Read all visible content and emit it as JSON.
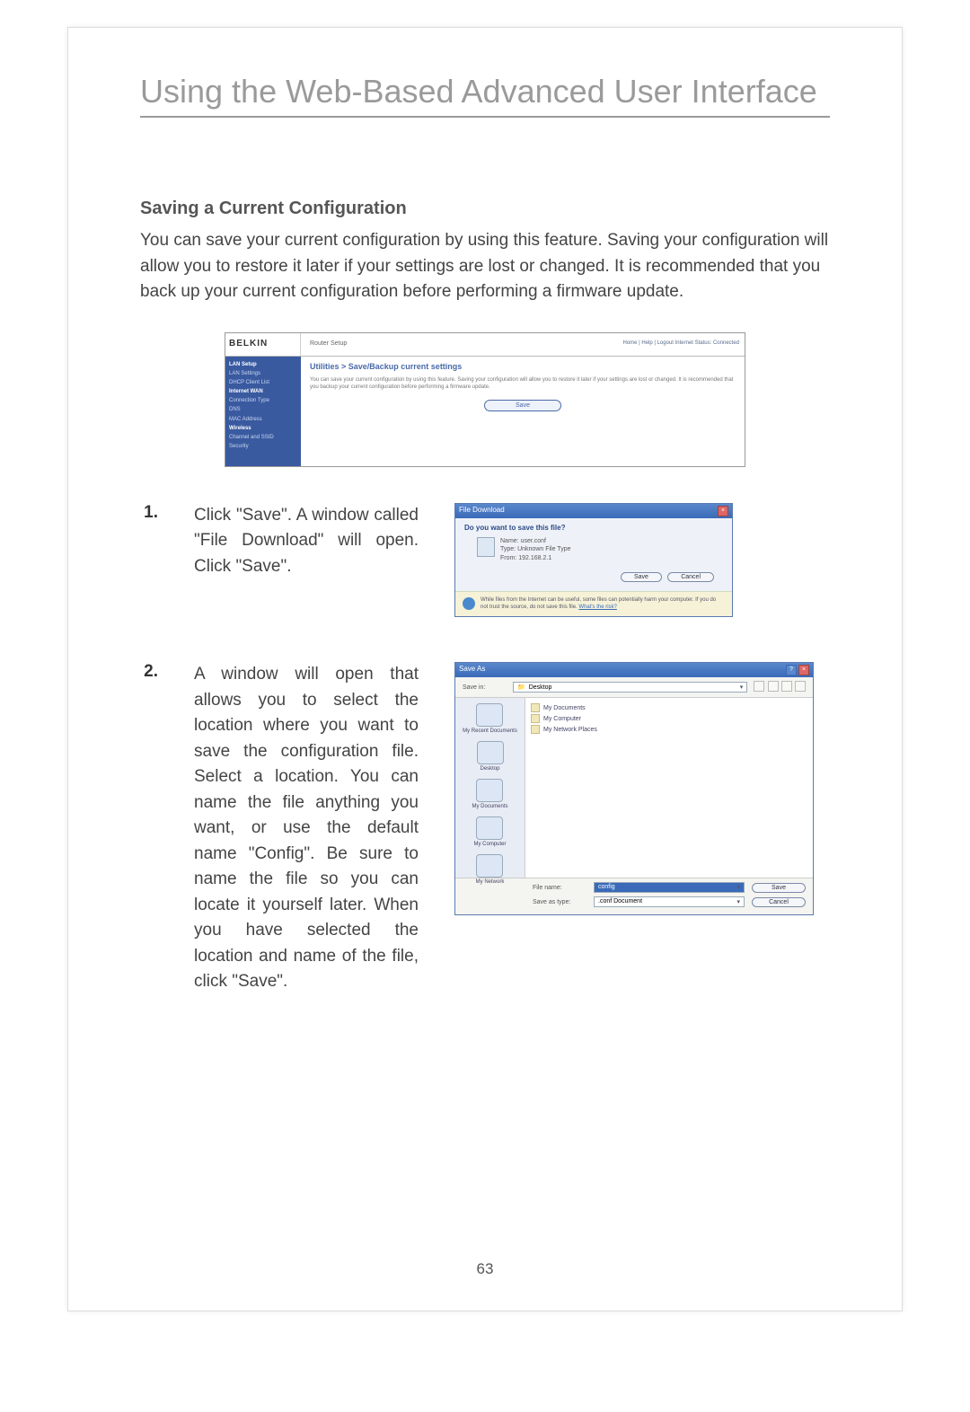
{
  "banner": "Using the Web-Based Advanced User Interface",
  "section_title": "Saving a Current Configuration",
  "intro": "You can save your current configuration by using this feature. Saving your configuration will allow you to restore it later if your settings are lost or changed. It is recommended that you back up your current configuration before performing a firmware update.",
  "page_number": "63",
  "router_ui": {
    "brand": "BELKIN",
    "top_center": "Router Setup",
    "top_right": "Home | Help | Logout   Internet Status: Connected",
    "sidebar": {
      "items": [
        "LAN Setup",
        "LAN Settings",
        "DHCP Client List",
        "Internet WAN",
        "Connection Type",
        "DNS",
        "MAC Address",
        "Wireless",
        "Channel and SSID",
        "Security"
      ]
    },
    "heading": "Utilities > Save/Backup current settings",
    "desc": "You can save your current configuration by using this feature. Saving your configuration will allow you to restore it later if your settings are lost or changed. It is recommended that you backup your current configuration before performing a firmware update.",
    "save_button": "Save"
  },
  "steps": {
    "s1": {
      "num": "1.",
      "text": "Click \"Save\". A window called \"File Download\" will open. Click \"Save\"."
    },
    "s2": {
      "num": "2.",
      "text": "A window will open that allows you to select the location where you want to save the configuration file. Select a location. You can name the file anything you want, or use the default name \"Config\". Be sure to name the file so you can locate it yourself later. When you have selected the location and name of the file, click \"Save\"."
    }
  },
  "file_download": {
    "title": "File Download",
    "question": "Do you want to save this file?",
    "name_label": "Name:",
    "name": "user.conf",
    "type_label": "Type:",
    "type": "Unknown File Type",
    "from_label": "From:",
    "from": "192.168.2.1",
    "btn_save": "Save",
    "btn_cancel": "Cancel",
    "warning": "While files from the Internet can be useful, some files can potentially harm your computer. If you do not trust the source, do not save this file.",
    "warning_link": "What's the risk?"
  },
  "save_as": {
    "title": "Save As",
    "savein_label": "Save in:",
    "savein_value": "Desktop",
    "places": [
      "My Recent Documents",
      "Desktop",
      "My Documents",
      "My Computer",
      "My Network"
    ],
    "folders": [
      "My Documents",
      "My Computer",
      "My Network Places"
    ],
    "filename_label": "File name:",
    "filename_value": "config",
    "savetype_label": "Save as type:",
    "savetype_value": ".conf Document",
    "btn_save": "Save",
    "btn_cancel": "Cancel"
  }
}
